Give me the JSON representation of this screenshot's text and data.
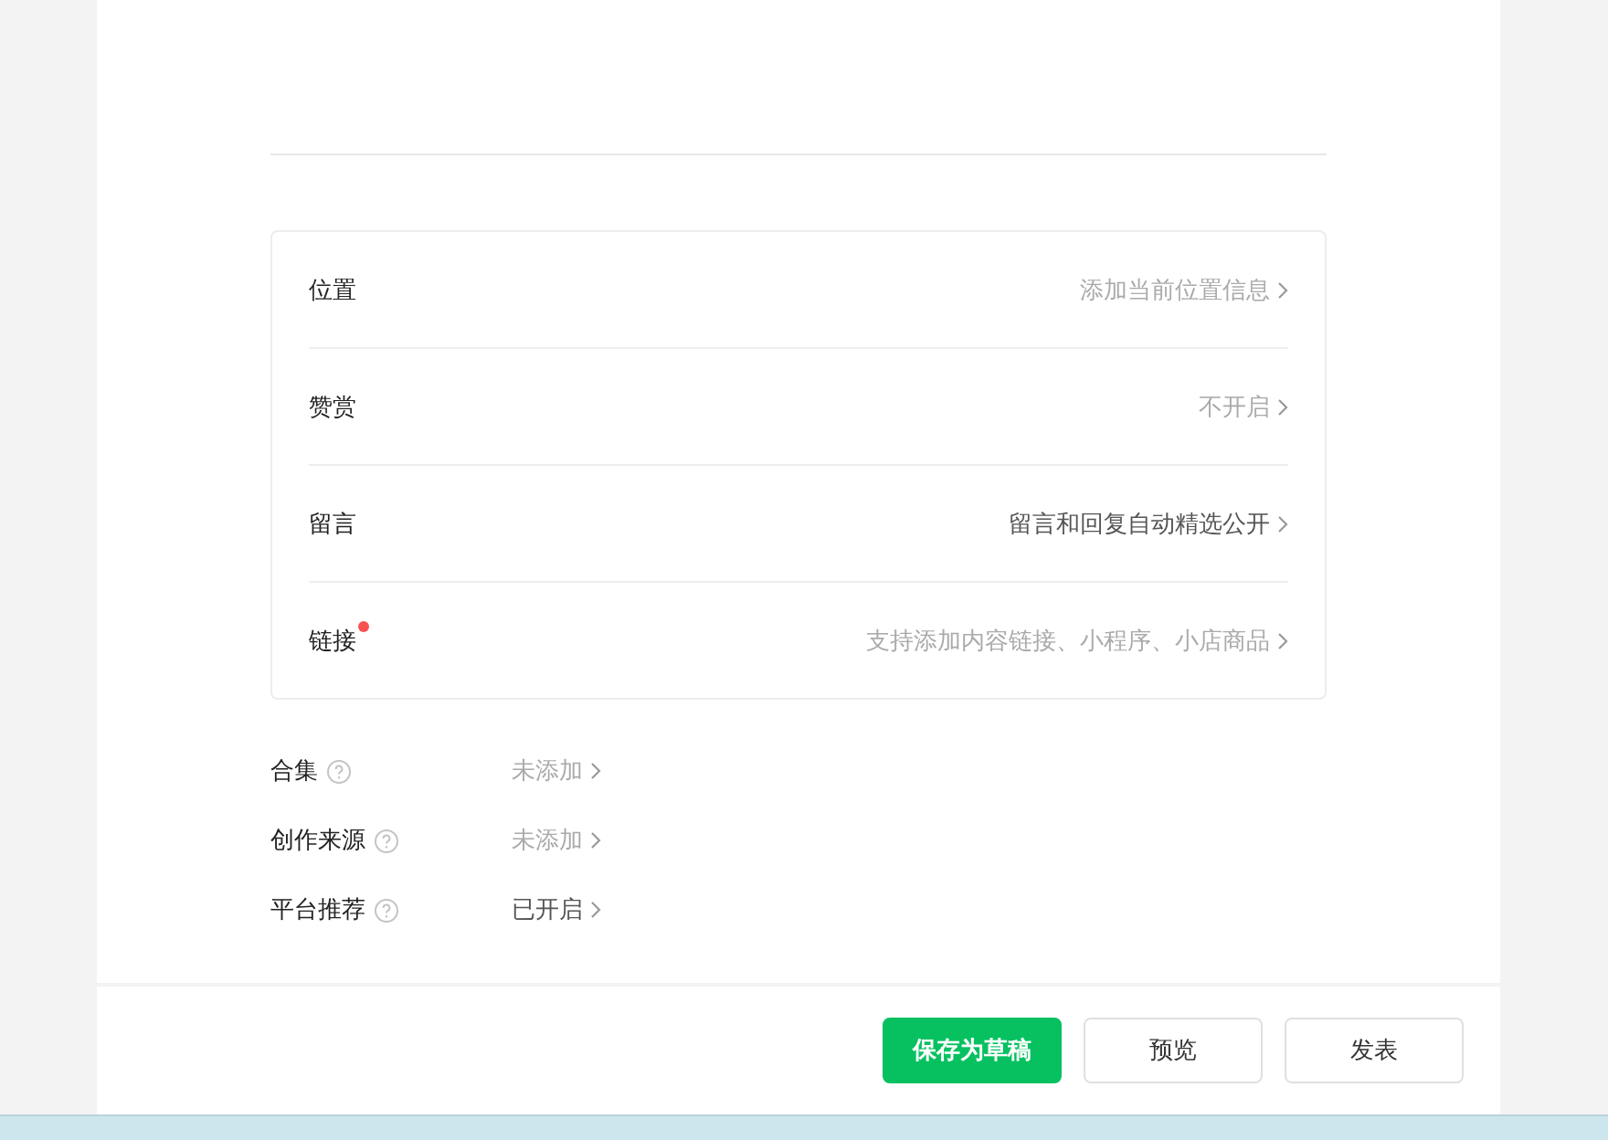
{
  "settings": [
    {
      "label": "位置",
      "value": "添加当前位置信息",
      "set": false,
      "dot": false
    },
    {
      "label": "赞赏",
      "value": "不开启",
      "set": false,
      "dot": false
    },
    {
      "label": "留言",
      "value": "留言和回复自动精选公开",
      "set": true,
      "dot": false
    },
    {
      "label": "链接",
      "value": "支持添加内容链接、小程序、小店商品",
      "set": false,
      "dot": true
    }
  ],
  "options": [
    {
      "label": "合集",
      "value": "未添加",
      "set": false
    },
    {
      "label": "创作来源",
      "value": "未添加",
      "set": false
    },
    {
      "label": "平台推荐",
      "value": "已开启",
      "set": true
    }
  ],
  "buttons": [
    {
      "label": "保存为草稿",
      "kind": "primary"
    },
    {
      "label": "预览",
      "kind": "default"
    },
    {
      "label": "发表",
      "kind": "default"
    }
  ]
}
